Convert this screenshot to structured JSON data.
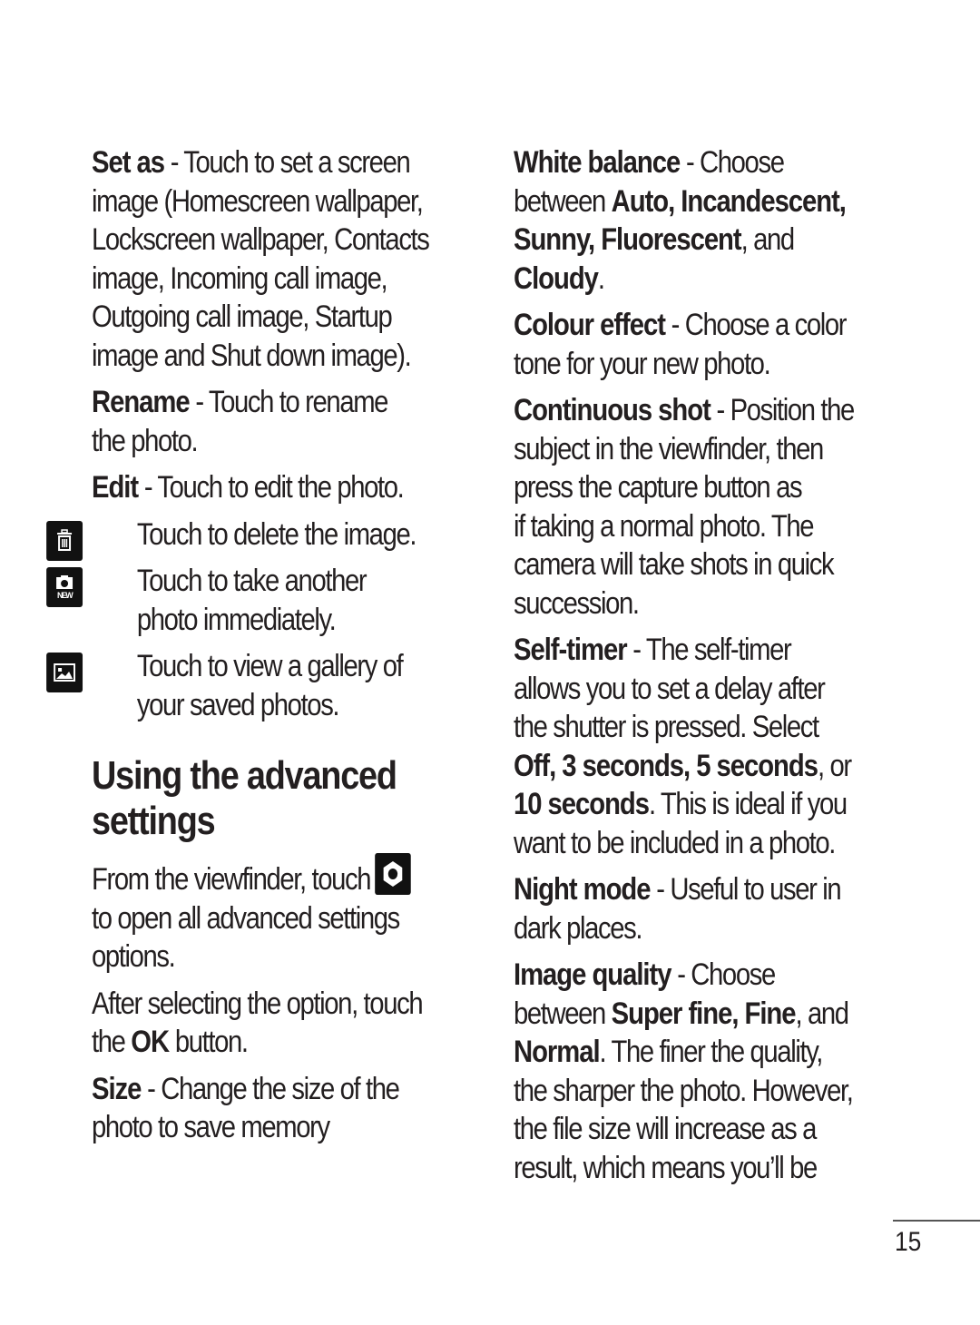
{
  "left_column": {
    "set_as": {
      "term": "Set as",
      "lines": [
        " - Touch to set a screen",
        "image (Homescreen wallpaper,",
        "Lockscreen wallpaper, Contacts",
        "image, Incoming call image,",
        "Outgoing call image, Startup",
        "image and Shut down image)."
      ]
    },
    "rename": {
      "term": "Rename",
      "lines": [
        " - Touch to rename",
        "the photo."
      ]
    },
    "edit": {
      "term": "Edit",
      "lines": [
        " - Touch to edit the photo."
      ]
    },
    "icon_items": [
      {
        "icon": "trash-icon",
        "lines": [
          "Touch to delete the image."
        ]
      },
      {
        "icon": "new-photo-icon",
        "icon_label": "NEW",
        "lines": [
          "Touch to take another",
          "photo immediately."
        ]
      },
      {
        "icon": "gallery-icon",
        "lines": [
          "Touch to view a gallery of",
          "your saved photos."
        ]
      }
    ],
    "heading": [
      "Using the advanced",
      "settings"
    ],
    "viewfinder": {
      "line1": "From the viewfinder, touch",
      "icon": "settings-gear-icon",
      "lines": [
        "to open all advanced settings",
        "options."
      ]
    },
    "after_selecting": {
      "line1": "After selecting the option, touch",
      "line2_pre": "the ",
      "line2_bold": "OK",
      "line2_post": " button."
    },
    "size": {
      "term": "Size",
      "lines": [
        " - Change the size of the",
        "photo to save memory"
      ]
    }
  },
  "right_column": {
    "white_balance": {
      "term": "White balance",
      "line1_rest": " - Choose",
      "line2_pre": "between ",
      "line2_bold": "Auto, Incandescent,",
      "line3_bold": "Sunny, Fluorescent",
      "line3_post": ", and",
      "line4_bold": "Cloudy",
      "line4_post": "."
    },
    "colour_effect": {
      "term": "Colour effect",
      "lines": [
        " - Choose a color",
        "tone for your new photo."
      ]
    },
    "continuous_shot": {
      "term": "Continuous shot",
      "lines": [
        " - Position the",
        "subject in the viewfinder, then",
        "press the capture button as",
        "if taking a normal photo. The",
        "camera will take shots in quick",
        "succession."
      ]
    },
    "self_timer": {
      "term": "Self-timer",
      "line1_rest": " - The self-timer",
      "line2": "allows you to set a delay after",
      "line3": "the shutter is pressed. Select",
      "line4_bold": "Off, 3 seconds, 5 seconds",
      "line4_post": ", or",
      "line5_bold": "10 seconds",
      "line5_post": ". This is ideal if you",
      "line6": "want to be included in a photo."
    },
    "night_mode": {
      "term": "Night mode",
      "lines": [
        " - Useful to user in",
        "dark places."
      ]
    },
    "image_quality": {
      "term": "Image quality",
      "line1_rest": " - Choose",
      "line2_pre": "between ",
      "line2_bold": "Super fine, Fine",
      "line2_post": ", and",
      "line3_bold": "Normal",
      "line3_post": ". The finer the quality,",
      "line4": "the sharper the photo. However,",
      "line5": "the file size will increase as a",
      "line6": "result, which means you’ll be"
    }
  },
  "footer": {
    "page_number": "15"
  }
}
